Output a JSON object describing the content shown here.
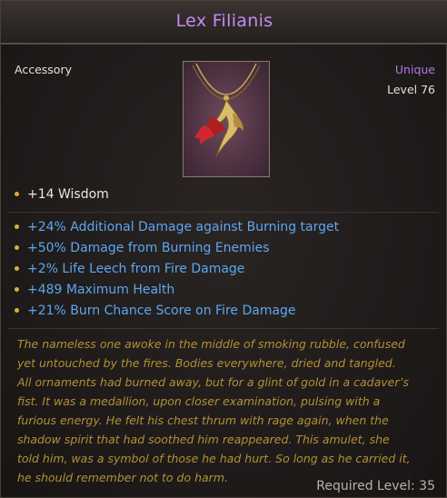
{
  "item": {
    "name": "Lex Filianis",
    "type": "Accessory",
    "rarity": "Unique",
    "level": "Level 76",
    "icon": "amulet-icon",
    "base_stats": [
      "+14 Wisdom"
    ],
    "affixes": [
      "+24% Additional Damage against Burning target",
      "+50% Damage from Burning Enemies",
      "+2% Life Leech from Fire Damage",
      "+489 Maximum Health",
      "+21% Burn Chance Score on Fire Damage"
    ],
    "lore_lines": [
      "The nameless one awoke in the middle of smoking rubble, confused",
      "yet untouched by the fires. Bodies everywhere, dried and tangled.",
      "All ornaments had burned away, but for a glint of gold in a cadaver’s",
      "fist. It was a medallion, upon closer examination, pulsing with a",
      "furious energy. He felt his chest thrum with rage again, when the",
      "shadow spirit that had soothed him reappeared. This amulet, she",
      "told him, was a symbol of those he had hurt. So long as he carried it,",
      "he should remember not to do harm."
    ],
    "required_level": "Required Level: 35"
  },
  "colors": {
    "title": "#c58af0",
    "rarity": "#b277e6",
    "affix": "#5ca7f2",
    "lore": "#b48f35",
    "bullet": "#e5a93a"
  }
}
